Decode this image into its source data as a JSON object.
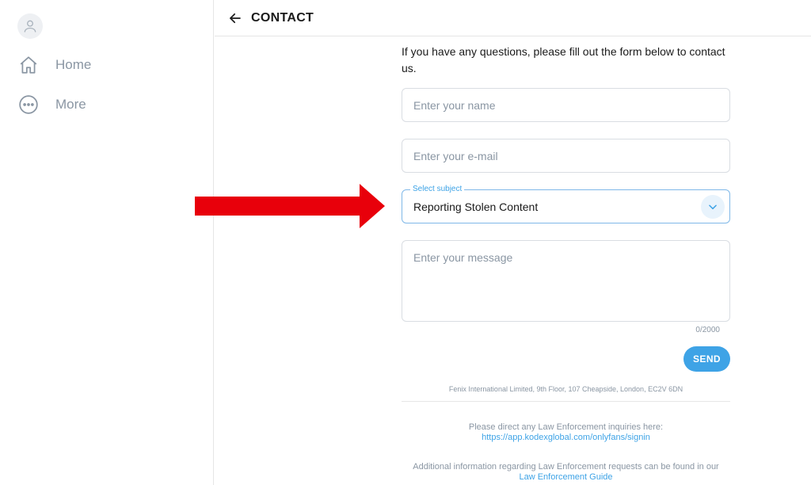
{
  "sidebar": {
    "items": [
      {
        "label": "Home",
        "icon": "home-icon"
      },
      {
        "label": "More",
        "icon": "more-icon"
      }
    ]
  },
  "header": {
    "title": "CONTACT"
  },
  "form": {
    "intro": "If you have any questions, please fill out the form below to contact us.",
    "name_placeholder": "Enter your name",
    "email_placeholder": "Enter your e-mail",
    "subject_label": "Select subject",
    "subject_value": "Reporting Stolen Content",
    "message_placeholder": "Enter your message",
    "counter": "0/2000",
    "send_label": "SEND"
  },
  "footer": {
    "address": "Fenix International Limited, 9th Floor, 107 Cheapside, London, EC2V 6DN",
    "law_text": "Please direct any Law Enforcement inquiries here:",
    "law_link": "https://app.kodexglobal.com/onlyfans/signin",
    "guide_text": "Additional information regarding Law Enforcement requests can be found in our",
    "guide_link": "Law Enforcement Guide"
  },
  "colors": {
    "accent": "#3ea3e6",
    "muted": "#8a96a3",
    "annotation_arrow": "#e8000b"
  }
}
